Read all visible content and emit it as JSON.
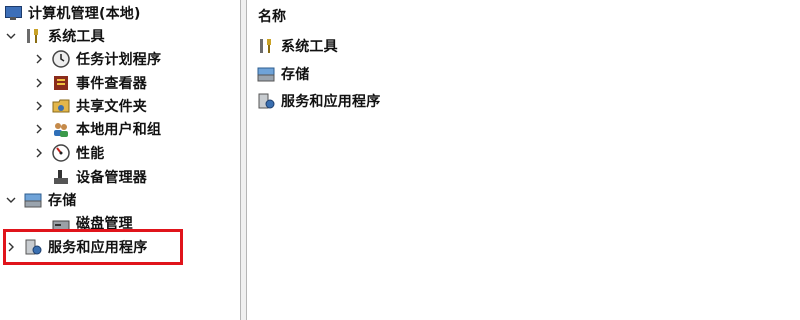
{
  "tree": {
    "root": "计算机管理(本地)",
    "system_tools": "系统工具",
    "task_scheduler": "任务计划程序",
    "event_viewer": "事件查看器",
    "shared_folders": "共享文件夹",
    "local_users": "本地用户和组",
    "performance": "性能",
    "device_manager": "设备管理器",
    "storage": "存储",
    "disk_management": "磁盘管理",
    "services_apps": "服务和应用程序"
  },
  "list": {
    "header": "名称",
    "items": [
      "系统工具",
      "存储",
      "服务和应用程序"
    ]
  },
  "colors": {
    "highlight": "#e0141b"
  }
}
